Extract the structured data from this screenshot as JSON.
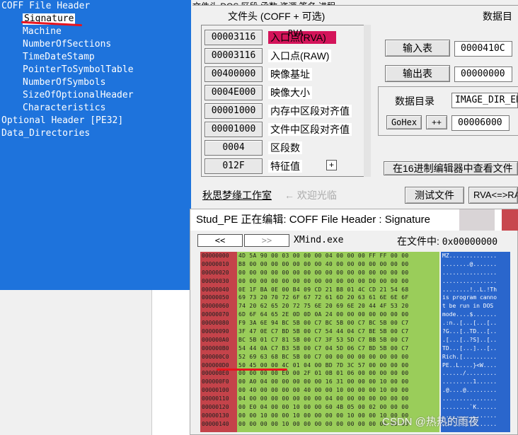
{
  "tree": {
    "items": [
      {
        "label": "COFF File Header",
        "prefix": "─",
        "indent": 0
      },
      {
        "label": "Signature",
        "prefix": "",
        "indent": 1,
        "selected": true
      },
      {
        "label": "Machine",
        "prefix": "",
        "indent": 1
      },
      {
        "label": "NumberOfSections",
        "prefix": "",
        "indent": 1
      },
      {
        "label": "TimeDateStamp",
        "prefix": "",
        "indent": 1
      },
      {
        "label": "PointerToSymbolTable",
        "prefix": "",
        "indent": 1
      },
      {
        "label": "NumberOfSymbols",
        "prefix": "",
        "indent": 1
      },
      {
        "label": "SizeOfOptionalHeader",
        "prefix": "",
        "indent": 1
      },
      {
        "label": "Characteristics",
        "prefix": "",
        "indent": 1
      },
      {
        "label": "Optional Header [PE32]",
        "prefix": "",
        "indent": 0
      },
      {
        "label": "Data_Directories",
        "prefix": "",
        "indent": 0
      }
    ]
  },
  "top_tabs": "文件头  DOS  区段  函数  资源  签名  进程",
  "header": {
    "left_title": "文件头 (COFF + 可选)",
    "right_title": "数据目"
  },
  "fields": [
    {
      "value": "00003116",
      "label": "入口点(RVA)",
      "highlight": true
    },
    {
      "value": "00003116",
      "label": "入口点(RAW)"
    },
    {
      "value": "00400000",
      "label": "映像基址"
    },
    {
      "value": "0004E000",
      "label": "映像大小"
    },
    {
      "value": "00001000",
      "label": "内存中区段对齐值"
    },
    {
      "value": "00001000",
      "label": "文件中区段对齐值"
    },
    {
      "value": "0004",
      "label": "区段数"
    },
    {
      "value": "012F",
      "label": "特征值",
      "plus": "+"
    }
  ],
  "rva_panel": {
    "rva_label": "RVA",
    "import_btn": "输入表",
    "import_val": "0000410C",
    "export_btn": "输出表",
    "export_val": "00000000",
    "dir_label": "数据目录",
    "dir_select": "IMAGE_DIR_EN",
    "gohex": "GoHex",
    "plusplus": "++",
    "gohex_val": "00006000",
    "view_hex_btn": "在16进制编辑器中查看文件"
  },
  "footer": {
    "author": "秋思梦缘工作室",
    "hint": "← 欢迎光临",
    "test_btn": "测试文件",
    "rva_raw_btn": "RVA<=>RA"
  },
  "editor": {
    "title": "Stud_PE 正在编辑: COFF File Header : Signature",
    "prev": "<<",
    "next": ">>",
    "filename": "XMind.exe",
    "offset_label": "在文件中:",
    "offset_value": "0x00000000",
    "rows": [
      {
        "addr": "00000000",
        "hex": "4D 5A 90 00 03 00 00 00 04 00 00 00 FF FF 00 00",
        "ascii": "MZ.............."
      },
      {
        "addr": "00000010",
        "hex": "B8 00 00 00 00 00 00 00 40 00 00 00 00 00 00 00",
        "ascii": "........@......."
      },
      {
        "addr": "00000020",
        "hex": "00 00 00 00 00 00 00 00 00 00 00 00 00 00 00 00",
        "ascii": "................"
      },
      {
        "addr": "00000030",
        "hex": "00 00 00 00 00 00 00 00 00 00 00 00 D0 00 00 00",
        "ascii": "................"
      },
      {
        "addr": "00000040",
        "hex": "0E 1F BA 0E 00 B4 09 CD 21 B8 01 4C CD 21 54 68",
        "ascii": "........!..L.!Th"
      },
      {
        "addr": "00000050",
        "hex": "69 73 20 70 72 6F 67 72 61 6D 20 63 61 6E 6E 6F",
        "ascii": "is program canno"
      },
      {
        "addr": "00000060",
        "hex": "74 20 62 65 20 72 75 6E 20 69 6E 20 44 4F 53 20",
        "ascii": "t be run in DOS "
      },
      {
        "addr": "00000070",
        "hex": "6D 6F 64 65 2E 0D 0D 0A 24 00 00 00 00 00 00 00",
        "ascii": "mode....$......."
      },
      {
        "addr": "00000080",
        "hex": "F9 3A 6E 94 BC 5B 00 C7 BC 5B 00 C7 BC 5B 00 C7",
        "ascii": ".:n..[...[...[.."
      },
      {
        "addr": "00000090",
        "hex": "3F 47 0E C7 BD 5B 00 C7 54 44 04 C7 BE 5B 00 C7",
        "ascii": "?G...[..TD...[.."
      },
      {
        "addr": "000000A0",
        "hex": "BC 5B 01 C7 81 5B 00 C7 3F 53 5D C7 BB 5B 00 C7",
        "ascii": ".[...[..?S]..[.."
      },
      {
        "addr": "000000B0",
        "hex": "54 44 0A C7 B3 5B 00 C7 04 5D 06 C7 BD 5B 00 C7",
        "ascii": "TD...[...]...[.."
      },
      {
        "addr": "000000C0",
        "hex": "52 69 63 68 BC 5B 00 C7 00 00 00 00 00 00 00 00",
        "ascii": "Rich.[.........."
      },
      {
        "addr": "000000D0",
        "hex": "50 45 00 00 4C 01 04 00 BD 7D 3C 57 00 00 00 00",
        "ascii": "PE..L....}<W...."
      },
      {
        "addr": "000000E0",
        "hex": "00 00 00 00 E0 00 2F 01 0B 01 06 00 00 00 00 00",
        "ascii": "....../........."
      },
      {
        "addr": "000000F0",
        "hex": "00 A0 04 00 00 00 00 00 16 31 00 00 00 10 00 00",
        "ascii": ".........1......"
      },
      {
        "addr": "00000100",
        "hex": "00 40 00 00 00 00 40 00 00 10 00 00 00 10 00 00",
        "ascii": ".@....@........."
      },
      {
        "addr": "00000110",
        "hex": "04 00 00 00 00 00 00 00 04 00 00 00 00 00 00 00",
        "ascii": "................"
      },
      {
        "addr": "00000120",
        "hex": "00 E0 04 00 00 10 00 00 60 4B 05 00 02 00 00 00",
        "ascii": "........`K......"
      },
      {
        "addr": "00000130",
        "hex": "00 00 10 00 00 10 00 00 00 00 10 00 00 10 00 00",
        "ascii": "................"
      },
      {
        "addr": "00000140",
        "hex": "00 00 00 00 10 00 00 00 00 00 00 00 00 00 00 00",
        "ascii": "................"
      }
    ]
  },
  "watermark": "CSDN @热热的雨夜",
  "colors": {
    "tree_bg": "#1e73dc",
    "addr_bg": "#c4434a",
    "hex_bg": "#9acd5a",
    "ascii_bg": "#2a66cc",
    "highlight": "#d4145a",
    "annotation": "#e8141e"
  }
}
